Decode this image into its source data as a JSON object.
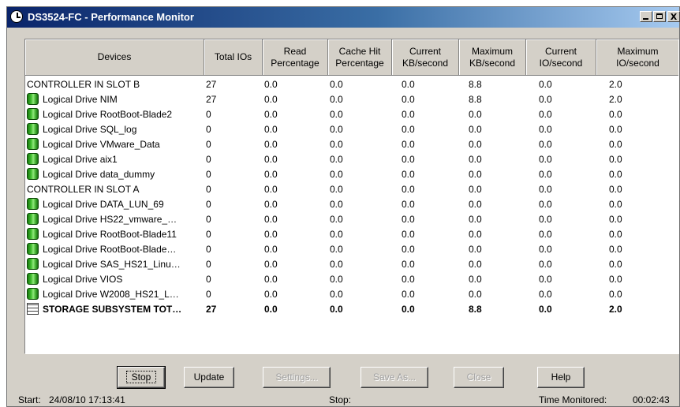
{
  "window": {
    "title": "DS3524-FC - Performance Monitor",
    "controls": [
      "_",
      "□",
      "X"
    ]
  },
  "columns": [
    "Devices",
    "Total IOs",
    "Read Percentage",
    "Cache Hit Percentage",
    "Current KB/second",
    "Maximum KB/second",
    "Current IO/second",
    "Maximum IO/second"
  ],
  "rows": [
    {
      "type": "controller",
      "name": "CONTROLLER IN SLOT B",
      "values": [
        "27",
        "0.0",
        "0.0",
        "0.0",
        "8.8",
        "0.0",
        "2.0"
      ]
    },
    {
      "type": "drive",
      "name": "Logical Drive NIM",
      "values": [
        "27",
        "0.0",
        "0.0",
        "0.0",
        "8.8",
        "0.0",
        "2.0"
      ]
    },
    {
      "type": "drive",
      "name": "Logical Drive RootBoot-Blade2",
      "values": [
        "0",
        "0.0",
        "0.0",
        "0.0",
        "0.0",
        "0.0",
        "0.0"
      ]
    },
    {
      "type": "drive",
      "name": "Logical Drive SQL_log",
      "values": [
        "0",
        "0.0",
        "0.0",
        "0.0",
        "0.0",
        "0.0",
        "0.0"
      ]
    },
    {
      "type": "drive",
      "name": "Logical Drive VMware_Data",
      "values": [
        "0",
        "0.0",
        "0.0",
        "0.0",
        "0.0",
        "0.0",
        "0.0"
      ]
    },
    {
      "type": "drive",
      "name": "Logical Drive aix1",
      "values": [
        "0",
        "0.0",
        "0.0",
        "0.0",
        "0.0",
        "0.0",
        "0.0"
      ]
    },
    {
      "type": "drive",
      "name": "Logical Drive data_dummy",
      "values": [
        "0",
        "0.0",
        "0.0",
        "0.0",
        "0.0",
        "0.0",
        "0.0"
      ]
    },
    {
      "type": "controller",
      "name": "CONTROLLER IN SLOT A",
      "values": [
        "0",
        "0.0",
        "0.0",
        "0.0",
        "0.0",
        "0.0",
        "0.0"
      ]
    },
    {
      "type": "drive",
      "name": "Logical Drive DATA_LUN_69",
      "values": [
        "0",
        "0.0",
        "0.0",
        "0.0",
        "0.0",
        "0.0",
        "0.0"
      ]
    },
    {
      "type": "drive",
      "name": "Logical Drive HS22_vmware_…",
      "values": [
        "0",
        "0.0",
        "0.0",
        "0.0",
        "0.0",
        "0.0",
        "0.0"
      ]
    },
    {
      "type": "drive",
      "name": "Logical Drive RootBoot-Blade11",
      "values": [
        "0",
        "0.0",
        "0.0",
        "0.0",
        "0.0",
        "0.0",
        "0.0"
      ]
    },
    {
      "type": "drive",
      "name": "Logical Drive RootBoot-Blade…",
      "values": [
        "0",
        "0.0",
        "0.0",
        "0.0",
        "0.0",
        "0.0",
        "0.0"
      ]
    },
    {
      "type": "drive",
      "name": "Logical Drive SAS_HS21_Linu…",
      "values": [
        "0",
        "0.0",
        "0.0",
        "0.0",
        "0.0",
        "0.0",
        "0.0"
      ]
    },
    {
      "type": "drive",
      "name": "Logical Drive VIOS",
      "values": [
        "0",
        "0.0",
        "0.0",
        "0.0",
        "0.0",
        "0.0",
        "0.0"
      ]
    },
    {
      "type": "drive",
      "name": "Logical Drive W2008_HS21_L…",
      "values": [
        "0",
        "0.0",
        "0.0",
        "0.0",
        "0.0",
        "0.0",
        "0.0"
      ]
    },
    {
      "type": "total",
      "name": "STORAGE SUBSYSTEM TOT…",
      "values": [
        "27",
        "0.0",
        "0.0",
        "0.0",
        "8.8",
        "0.0",
        "2.0"
      ]
    }
  ],
  "buttons": [
    {
      "label": "Stop",
      "enabled": true,
      "default": true
    },
    {
      "label": "Update",
      "enabled": true,
      "default": false
    },
    {
      "label": "Settings...",
      "enabled": false,
      "default": false
    },
    {
      "label": "Save As...",
      "enabled": false,
      "default": false
    },
    {
      "label": "Close",
      "enabled": false,
      "default": false
    },
    {
      "label": "Help",
      "enabled": true,
      "default": false
    }
  ],
  "status": {
    "start_label": "Start:",
    "start_value": "24/08/10 17:13:41",
    "stop_label": "Stop:",
    "monitored_label": "Time Monitored:",
    "monitored_value": "00:02:43"
  },
  "icons": {
    "drive": "logical-drive-icon",
    "total": "storage-subsystem-icon",
    "window": "clock-icon"
  }
}
